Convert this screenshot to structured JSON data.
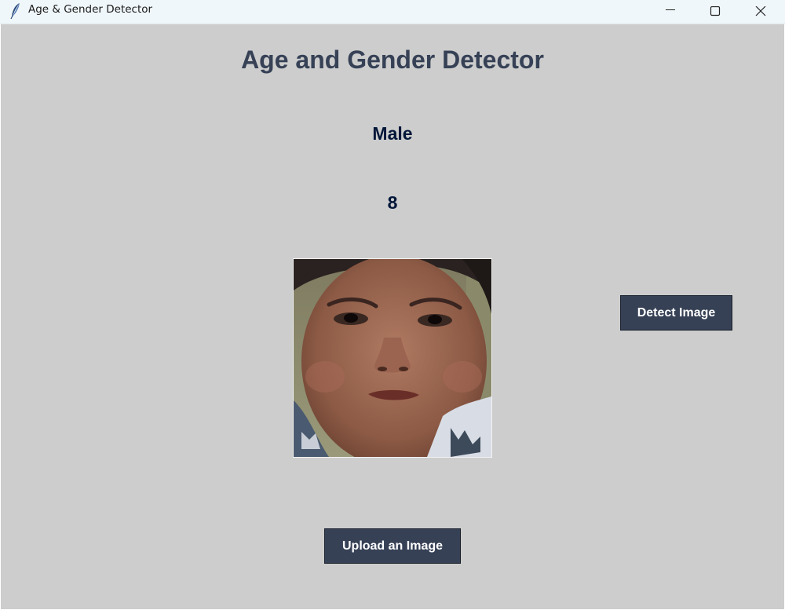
{
  "window": {
    "title": "Age & Gender Detector",
    "icon": "feather-icon",
    "controls": [
      "minimize-icon",
      "maximize-icon",
      "close-icon"
    ]
  },
  "main": {
    "heading": "Age and Gender Detector",
    "gender_result": "Male",
    "age_result": "8",
    "detect_button": "Detect Image",
    "upload_button": "Upload an Image"
  },
  "colors": {
    "background": "#cdcdcd",
    "heading": "#364156",
    "result_text": "#011638",
    "button_bg": "#364156",
    "button_text": "#ffffff"
  }
}
